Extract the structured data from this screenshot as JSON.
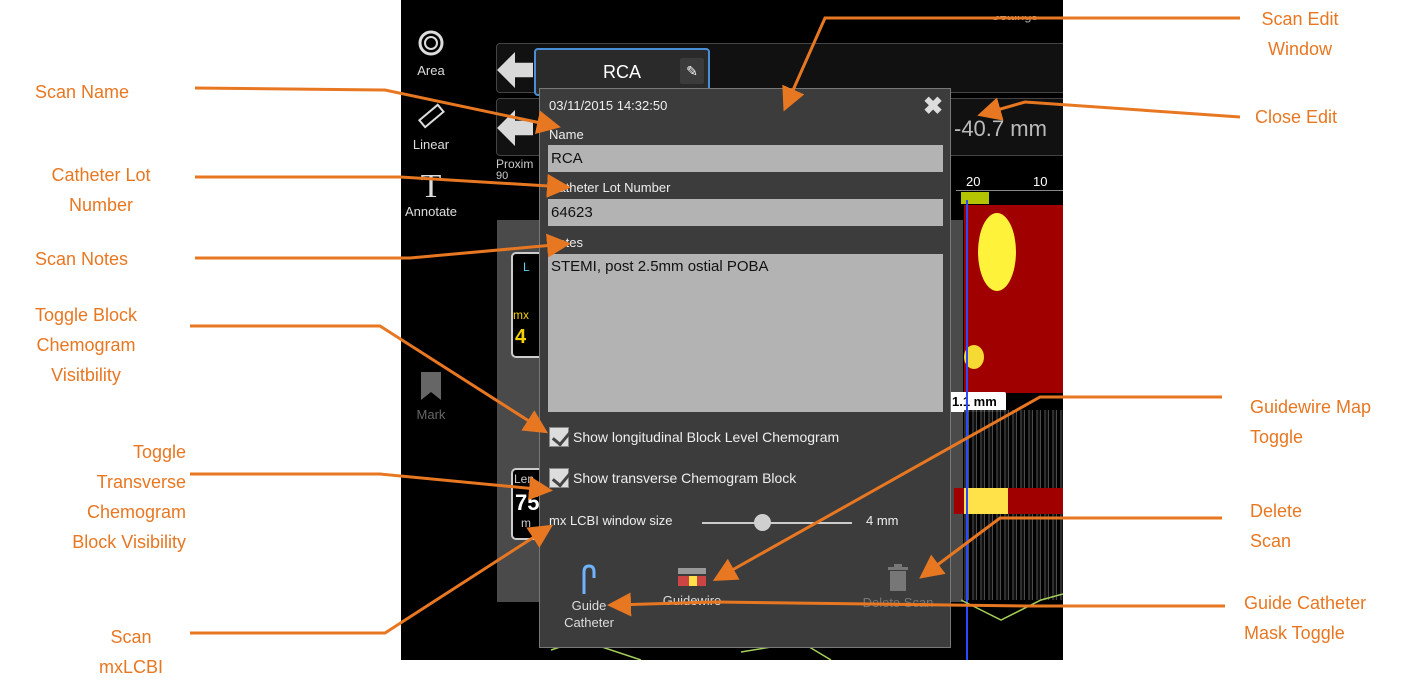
{
  "toolbar": {
    "area": "Area",
    "linear": "Linear",
    "annotate": "Annotate",
    "mark": "Mark"
  },
  "top": {
    "scan_tab": "RCA",
    "length_partial": "-40.7 mm",
    "settings_partial": "Settings",
    "proximal_partial": "Proxim",
    "proximal_value": "90",
    "ruler_labels": [
      "20",
      "10"
    ],
    "length_marker": "1.1 mm"
  },
  "side_panels": {
    "lcbi_label": "L",
    "mx_label": "mx",
    "value": "4",
    "len_label": "Len",
    "len_value": "75",
    "len_unit": "m"
  },
  "dialog": {
    "timestamp": "03/11/2015 14:32:50",
    "name_label": "Name",
    "name_value": "RCA",
    "lot_label": "Catheter Lot Number",
    "lot_value": "64623",
    "notes_label": "Notes",
    "notes_value": "STEMI, post 2.5mm ostial POBA",
    "check1": "Show longitudinal Block Level Chemogram",
    "check2": "Show transverse Chemogram Block",
    "slider_label": "mx LCBI window size",
    "slider_value": "4 mm",
    "slider_fraction": 0.35,
    "guide_catheter_line1": "Guide",
    "guide_catheter_line2": "Catheter",
    "guidewire": "Guidewire",
    "delete_scan": "Delete Scan"
  },
  "annotations": {
    "scan_name": "Scan Name",
    "catheter_lot": "Catheter Lot Number",
    "scan_notes": "Scan Notes",
    "toggle_block": "Toggle Block Chemogram Visitbility",
    "toggle_transverse": "Toggle Transverse Chemogram Block Visibility",
    "scan_mxlcbi": "Scan mxLCBI",
    "scan_edit": "Scan Edit Window",
    "close_edit": "Close Edit",
    "guidewire_map": "Guidewire Map Toggle",
    "delete_scan": "Delete Scan",
    "guide_mask": "Guide Catheter Mask Toggle"
  },
  "colors": {
    "annotation": "#e87722",
    "accent_blue": "#4a8fd6"
  }
}
